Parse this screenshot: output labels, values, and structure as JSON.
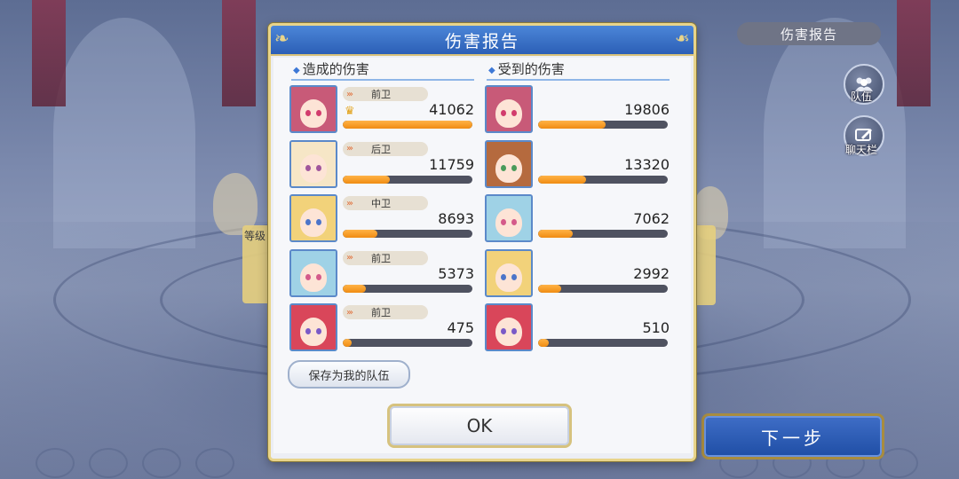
{
  "hud": {
    "header_label": "伤害报告",
    "team_button_label": "队伍",
    "chat_button_label": "聊天栏",
    "next_button_label": "下一步",
    "level_tag_label": "等级"
  },
  "dialog": {
    "title": "伤害报告",
    "dealt_header": "造成的伤害",
    "taken_header": "受到的伤害",
    "save_team_label": "保存为我的队伍",
    "ok_label": "OK"
  },
  "damage_dealt": [
    {
      "role": "前卫",
      "value": "41062",
      "ratio": 1.0,
      "top": true,
      "hair": "#c85a78",
      "eye": "#d23c6d"
    },
    {
      "role": "后卫",
      "value": "11759",
      "ratio": 0.36,
      "top": false,
      "hair": "#f6e6c6",
      "eye": "#a0559c"
    },
    {
      "role": "中卫",
      "value": "8693",
      "ratio": 0.27,
      "top": false,
      "hair": "#f2d27a",
      "eye": "#4c74c9"
    },
    {
      "role": "前卫",
      "value": "5373",
      "ratio": 0.18,
      "top": false,
      "hair": "#9fd2e6",
      "eye": "#d45a8a"
    },
    {
      "role": "前卫",
      "value": "475",
      "ratio": 0.07,
      "top": false,
      "hair": "#d9465a",
      "eye": "#7a5ac7"
    }
  ],
  "damage_taken": [
    {
      "value": "19806",
      "ratio": 0.52,
      "hair": "#c85a78",
      "eye": "#d23c6d"
    },
    {
      "value": "13320",
      "ratio": 0.37,
      "hair": "#b56a3e",
      "eye": "#4a9a5a"
    },
    {
      "value": "7062",
      "ratio": 0.27,
      "hair": "#9fd2e6",
      "eye": "#d45a8a"
    },
    {
      "value": "2992",
      "ratio": 0.18,
      "hair": "#f2d27a",
      "eye": "#4c74c9"
    },
    {
      "value": "510",
      "ratio": 0.08,
      "hair": "#d9465a",
      "eye": "#7a5ac7"
    }
  ]
}
